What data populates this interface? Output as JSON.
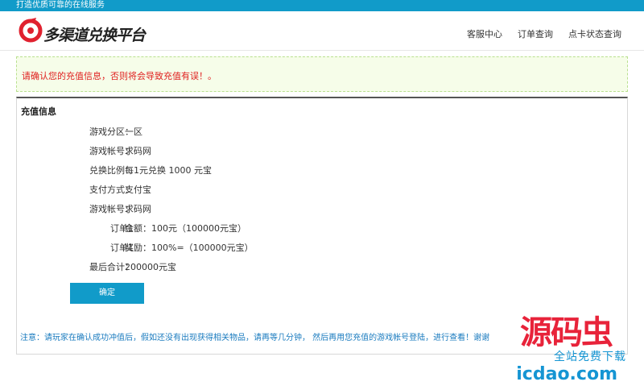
{
  "topbar": {
    "slogan": "打造优质可靠的在线服务"
  },
  "header": {
    "logo_text": "多渠道兑换平台",
    "nav": [
      "客服中心",
      "订单查询",
      "点卡状态查询"
    ]
  },
  "alert": {
    "text": "请确认您的充值信息，否则将会导致充值有误！。"
  },
  "panel": {
    "title": "充值信息",
    "rows": [
      {
        "label": "游戏分区：",
        "value": "一区"
      },
      {
        "label": "游戏帐号：",
        "value": "求码网"
      },
      {
        "label": "兑换比例：",
        "value": "每1元兑换 1000 元宝"
      },
      {
        "label": "支付方式：",
        "value": "支付宝"
      },
      {
        "label": "游戏帐号：",
        "value": "求码网"
      },
      {
        "label": "订单1",
        "value": "金额：100元（100000元宝）"
      },
      {
        "label": "订单1",
        "value": "奖励：100%=（100000元宝）"
      },
      {
        "label": "最后合计：",
        "value": "200000元宝"
      }
    ],
    "confirm_label": "确定",
    "note": "注意：请玩家在确认成功冲值后，假如还没有出现获得相关物品，请再等几分钟， 然后再用您充值的游戏帐号登陆，进行查看！谢谢"
  },
  "watermark": {
    "big": "源码虫",
    "small": "全站免费下载",
    "url": "icdao.com"
  },
  "colors": {
    "topbar": "#119bc9",
    "button": "#119bc9",
    "alert_text": "#e02020",
    "note_text": "#1a7bbf",
    "watermark_red": "#e8233a"
  }
}
